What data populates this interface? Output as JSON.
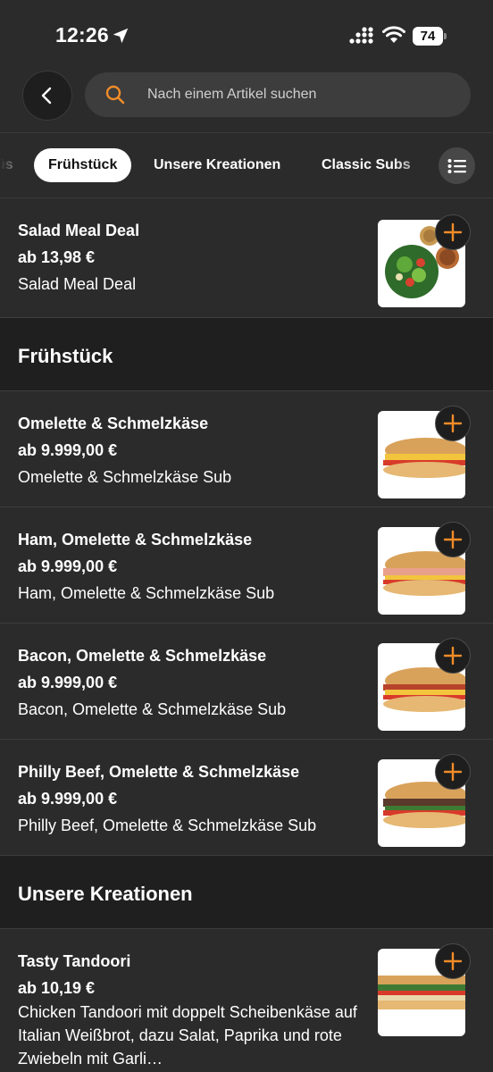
{
  "status": {
    "time": "12:26",
    "battery": "74"
  },
  "search": {
    "placeholder": "Nach einem Artikel suchen"
  },
  "tabs": [
    {
      "label": "üs"
    },
    {
      "label": "Frühstück"
    },
    {
      "label": "Unsere Kreationen"
    },
    {
      "label": "Classic Subs"
    }
  ],
  "items_top": {
    "name": "Salad Meal Deal",
    "price": "ab 13,98 €",
    "desc": "Salad Meal Deal"
  },
  "sections": [
    {
      "title": "Frühstück",
      "items": [
        {
          "name": "Omelette & Schmelzkäse",
          "price": "ab 9.999,00 €",
          "desc": "Omelette & Schmelzkäse Sub"
        },
        {
          "name": "Ham, Omelette & Schmelzkäse",
          "price": "ab 9.999,00 €",
          "desc": "Ham, Omelette & Schmelzkäse Sub"
        },
        {
          "name": "Bacon, Omelette & Schmelzkäse",
          "price": "ab 9.999,00 €",
          "desc": "Bacon, Omelette & Schmelzkäse Sub"
        },
        {
          "name": "Philly Beef, Omelette & Schmelzkäse",
          "price": "ab 9.999,00 €",
          "desc": "Philly Beef, Omelette & Schmelzkäse Sub"
        }
      ]
    },
    {
      "title": "Unsere Kreationen",
      "items": [
        {
          "name": "Tasty Tandoori",
          "price": "ab 10,19 €",
          "desc": "Chicken Tandoori mit doppelt Scheibenkäse auf Italian Weißbrot, dazu Salat, Paprika und rote Zwiebeln mit Garli…"
        }
      ]
    }
  ],
  "colors": {
    "accent": "#f28c28",
    "background": "#2b2b2b",
    "section_bg": "#1f1f1f"
  },
  "icons": {
    "back": "chevron-left-icon",
    "search": "search-icon",
    "menu": "list-icon",
    "add": "plus-icon"
  }
}
